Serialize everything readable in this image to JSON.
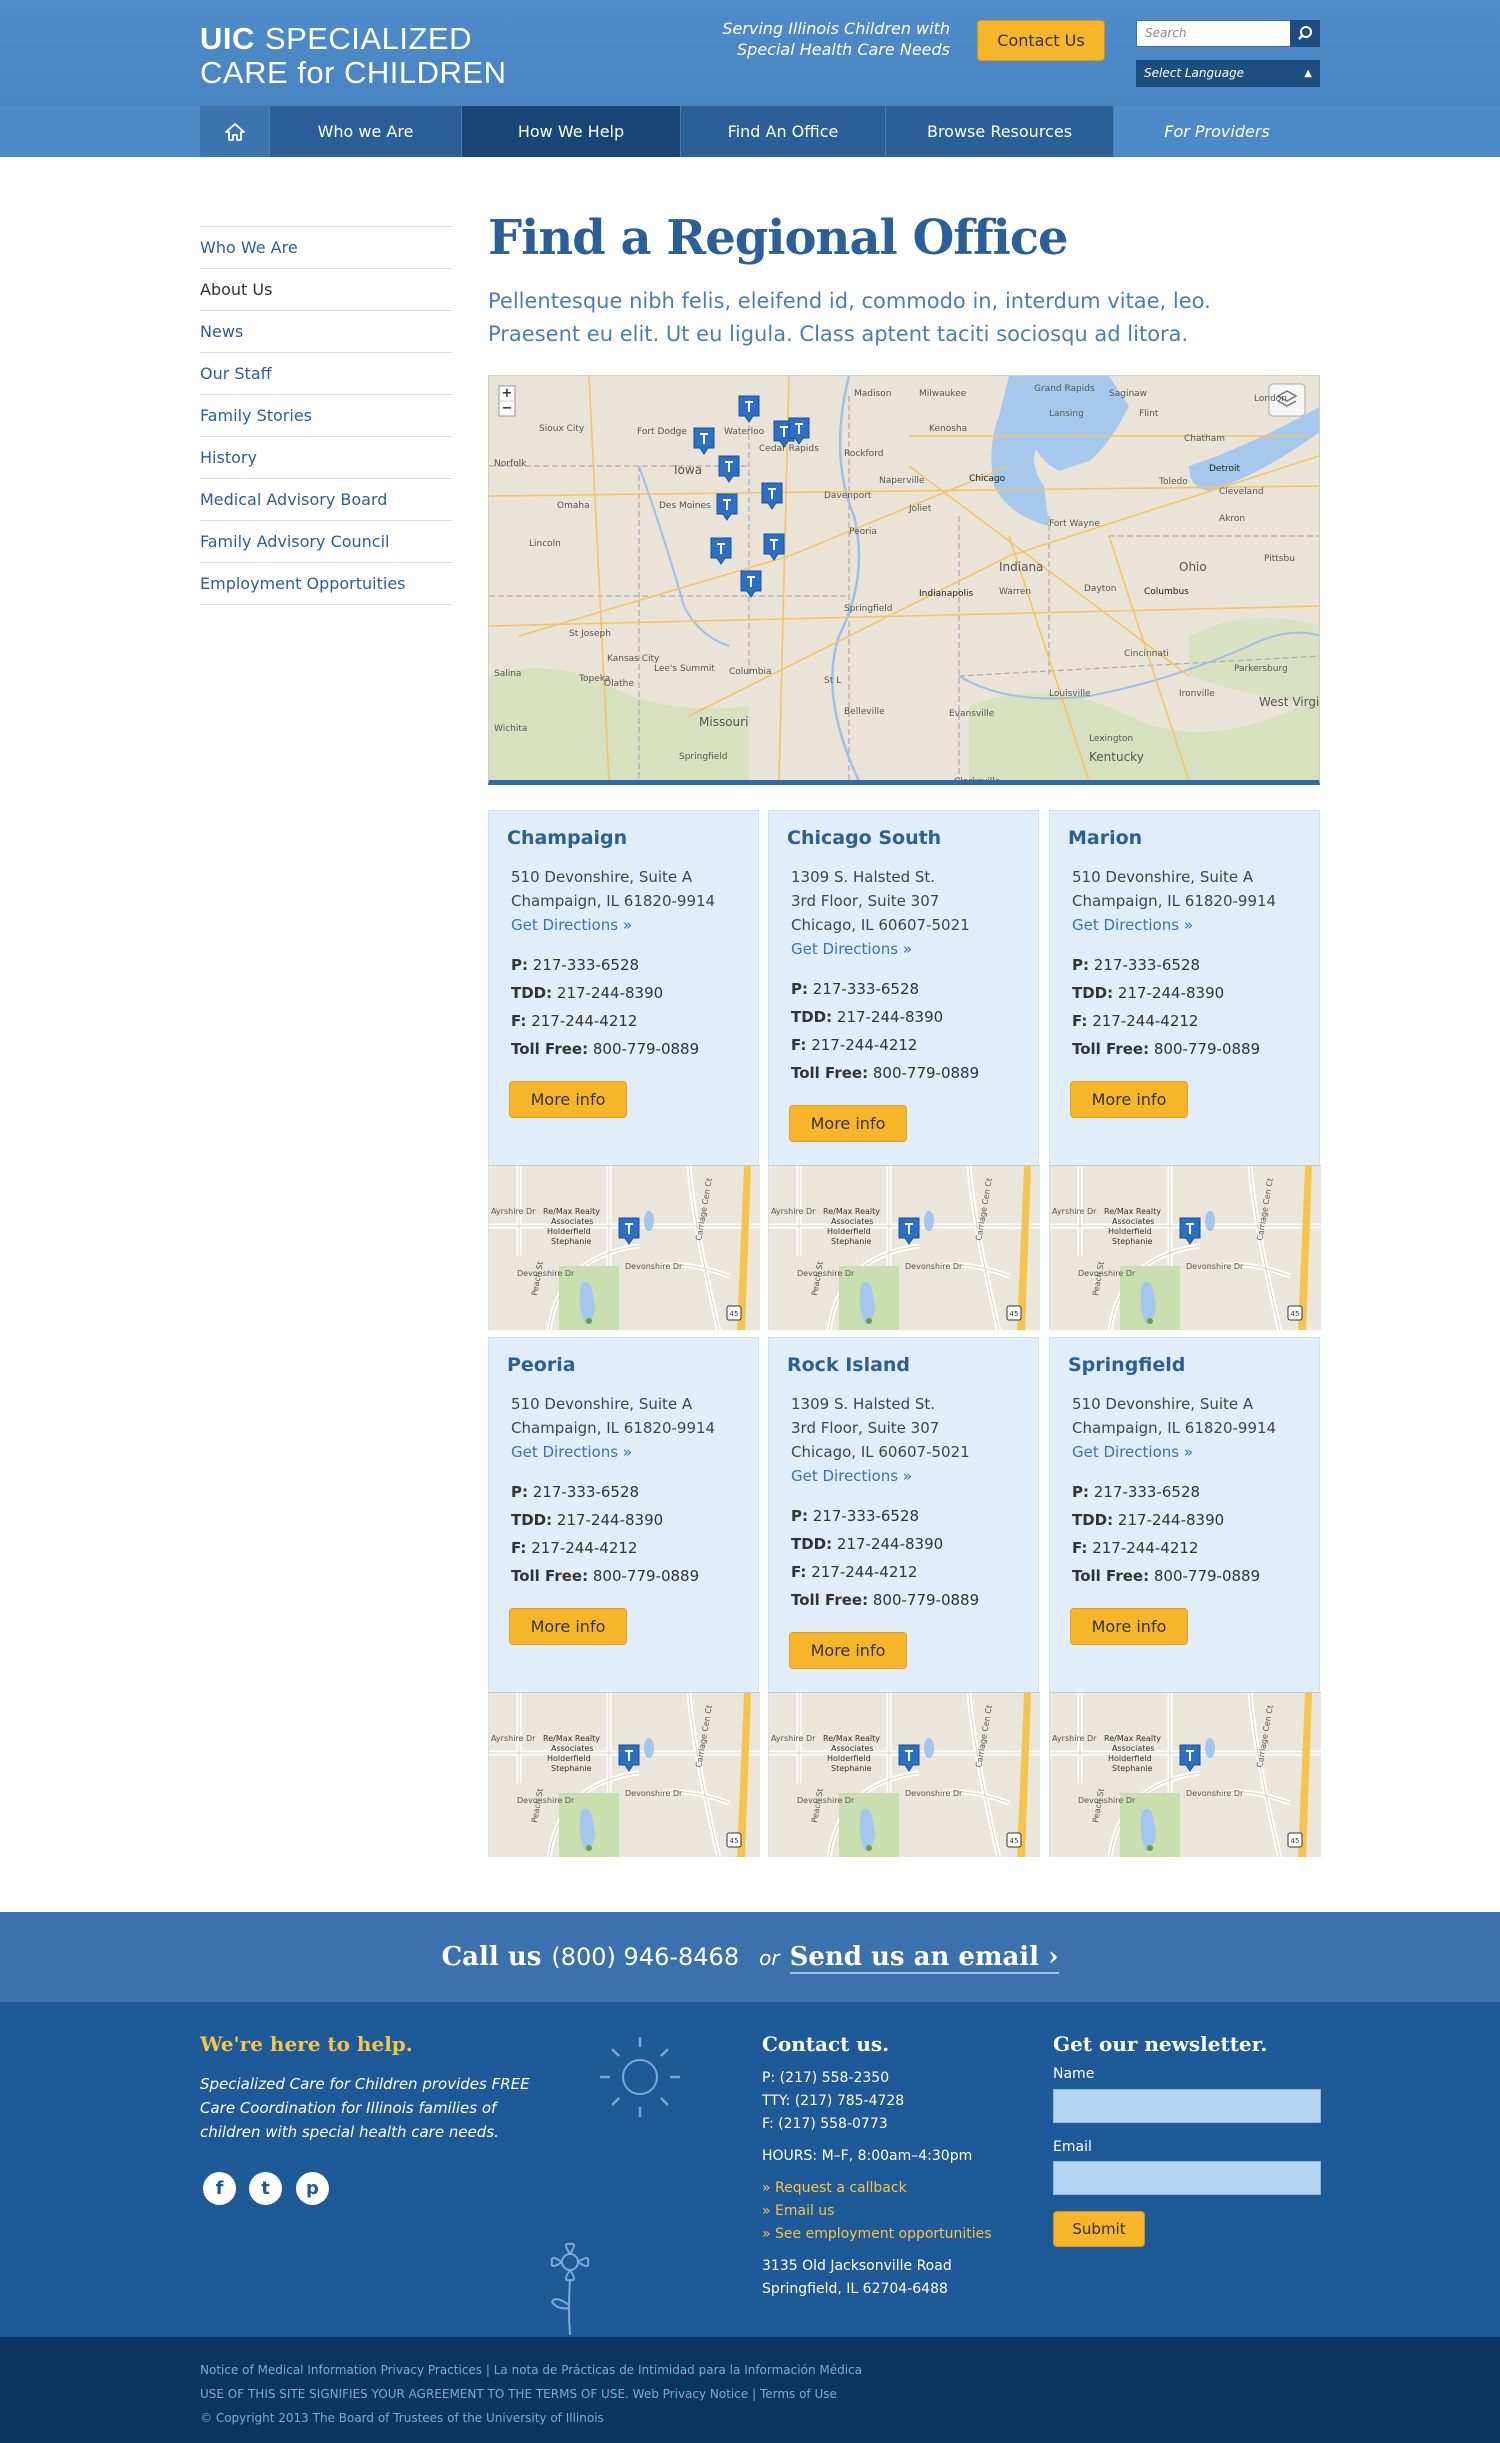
{
  "header": {
    "logo_line1_bold": "UIC",
    "logo_line1": "SPECIALIZED",
    "logo_line2": "CARE for CHILDREN",
    "tagline_line1": "Serving Illinois Children with",
    "tagline_line2": "Special Health Care Needs",
    "contact_button": "Contact Us",
    "search_placeholder": "Search",
    "language_select": "Select Language"
  },
  "nav": {
    "items": [
      "Who we Are",
      "How We Help",
      "Find An Office",
      "Browse Resources",
      "For Providers"
    ]
  },
  "sidebar": {
    "items": [
      "Who We Are",
      "About Us",
      "News",
      "Our Staff",
      "Family Stories",
      "History",
      "Medical Advisory Board",
      "Family Advisory Council",
      "Employment Opportuities"
    ]
  },
  "main": {
    "title": "Find a Regional Office",
    "lead_line1": "Pellentesque nibh felis, eleifend id, commodo in, interdum vitae, leo.",
    "lead_line2": "Praesent eu elit. Ut eu ligula. Class aptent taciti sociosqu ad litora."
  },
  "map": {
    "cities": [
      "Madison",
      "Milwaukee",
      "Grand Rapids",
      "Saginaw",
      "Lansing",
      "Flint",
      "London",
      "Sioux City",
      "Fort Dodge",
      "Waterloo",
      "Cedar Rapids",
      "Rockford",
      "Kenosha",
      "Chicago",
      "Naperville",
      "Joliet",
      "Chatham",
      "Detroit",
      "Toledo",
      "Cleveland",
      "Norfolk",
      "Iowa",
      "Davenport",
      "Fort Wayne",
      "Akron",
      "Omaha",
      "Des Moines",
      "Peoria",
      "Indiana",
      "Lincoln",
      "Ohio",
      "Pittsbu",
      "Springfield",
      "Indianapolis",
      "Warren",
      "Dayton",
      "Columbus",
      "St Joseph",
      "Kansas City",
      "Lee's Summit",
      "Olathe",
      "Columbia",
      "Salina",
      "Topeka",
      "Missouri",
      "St L",
      "Belleville",
      "Cincinnati",
      "Parkersburg",
      "Louisville",
      "Ironville",
      "West Virginia",
      "Evansville",
      "Lexington",
      "Wichita",
      "Springfield",
      "Kentucky",
      "Clarksville"
    ],
    "zoom_in": "+",
    "zoom_out": "−"
  },
  "offices": [
    {
      "name": "Champaign",
      "addr": [
        "510 Devonshire, Suite A",
        "Champaign, IL 61820-9914"
      ],
      "directions": "Get Directions »",
      "p": "217-333-6528",
      "tdd": "217-244-8390",
      "f": "217-244-4212",
      "toll": "800-779-0889",
      "more": "More info"
    },
    {
      "name": "Chicago South",
      "addr": [
        "1309 S. Halsted St.",
        "3rd Floor, Suite 307",
        "Chicago, IL 60607-5021"
      ],
      "directions": "Get Directions »",
      "p": "217-333-6528",
      "tdd": "217-244-8390",
      "f": "217-244-4212",
      "toll": "800-779-0889",
      "more": "More info"
    },
    {
      "name": "Marion",
      "addr": [
        "510 Devonshire, Suite A",
        "Champaign, IL 61820-9914"
      ],
      "directions": "Get Directions »",
      "p": "217-333-6528",
      "tdd": "217-244-8390",
      "f": "217-244-4212",
      "toll": "800-779-0889",
      "more": "More info"
    },
    {
      "name": "Peoria",
      "addr": [
        "510 Devonshire, Suite A",
        "Champaign, IL 61820-9914"
      ],
      "directions": "Get Directions »",
      "p": "217-333-6528",
      "tdd": "217-244-8390",
      "f": "217-244-4212",
      "toll": "800-779-0889",
      "more": "More info"
    },
    {
      "name": "Rock Island",
      "addr": [
        "1309 S. Halsted St.",
        "3rd Floor, Suite 307",
        "Chicago, IL 60607-5021"
      ],
      "directions": "Get Directions »",
      "p": "217-333-6528",
      "tdd": "217-244-8390",
      "f": "217-244-4212",
      "toll": "800-779-0889",
      "more": "More info"
    },
    {
      "name": "Springfield",
      "addr": [
        "510 Devonshire, Suite A",
        "Champaign, IL 61820-9914"
      ],
      "directions": "Get Directions »",
      "p": "217-333-6528",
      "tdd": "217-244-8390",
      "f": "217-244-4212",
      "toll": "800-779-0889",
      "more": "More info"
    }
  ],
  "labels": {
    "p": "P:",
    "tdd": "TDD:",
    "f": "F:",
    "toll": "Toll Free:"
  },
  "mini_map": {
    "l1": "Re/Max Realty",
    "l2": "Associates",
    "l3": "Holderfield",
    "l4": "Stephanie",
    "s1": "Ayrshire Dr",
    "s2": "Devonshire Dr",
    "s3": "Devonshire Dr",
    "s4": "Peach St",
    "s5": "Carriage Cen Ct",
    "s6": "45"
  },
  "callbar": {
    "call": "Call us",
    "number": "(800) 946-8468",
    "or": "or",
    "email": "Send us an email ›"
  },
  "footer": {
    "help_title": "We're here to help.",
    "help_text": "Specialized Care for Children provides FREE Care Coordination for Illinois families of children with special health care needs.",
    "social": [
      "f",
      "t",
      "p"
    ],
    "contact_title": "Contact us.",
    "phone": "P: (217) 558-2350",
    "tty": "TTY: (217) 785-4728",
    "fax": "F: (217) 558-0773",
    "hours": "HOURS: M–F, 8:00am–4:30pm",
    "links": [
      "» Request a callback",
      "» Email us",
      "» See employment opportunities"
    ],
    "address1": "3135 Old Jacksonville Road",
    "address2": "Springfield, IL 62704-6488",
    "newsletter_title": "Get our newsletter.",
    "name_label": "Name",
    "email_label": "Email",
    "submit": "Submit"
  },
  "legal": {
    "line1a": "Notice of Medical Information Privacy Practices",
    "line1b": "La nota de Prácticas de Intimidad para la Información Médica",
    "line2a": "USE OF THIS SITE SIGNIFIES YOUR AGREEMENT TO THE TERMS OF USE.",
    "line2b": "Web Privacy Notice",
    "line2c": "Terms of Use",
    "line3": "© Copyright 2013 The Board of Trustees of the University of Illinois"
  },
  "colors": {
    "brand_blue": "#2a5f97",
    "header_blue": "#4a88c6",
    "accent_yellow": "#f7b52a",
    "footer_blue": "#1e5a97",
    "legal_blue": "#0b3462"
  }
}
